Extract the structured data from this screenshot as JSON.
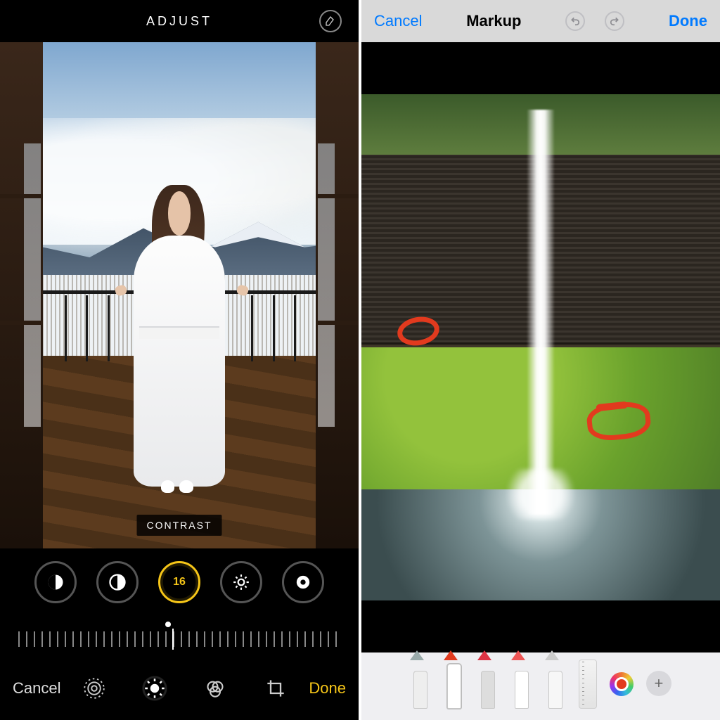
{
  "left": {
    "header_title": "ADJUST",
    "photo_label": "CONTRAST",
    "adjustments": {
      "active_value": "16",
      "items": [
        "exposure",
        "brilliance",
        "contrast",
        "brightness",
        "black-point"
      ]
    },
    "bottom": {
      "cancel_label": "Cancel",
      "done_label": "Done"
    }
  },
  "right": {
    "header": {
      "cancel_label": "Cancel",
      "title": "Markup",
      "done_label": "Done"
    },
    "tools": {
      "items": [
        "pen",
        "marker",
        "crayon",
        "eraser",
        "lasso",
        "ruler"
      ],
      "selected": "marker",
      "color": "#e23a1e"
    }
  }
}
